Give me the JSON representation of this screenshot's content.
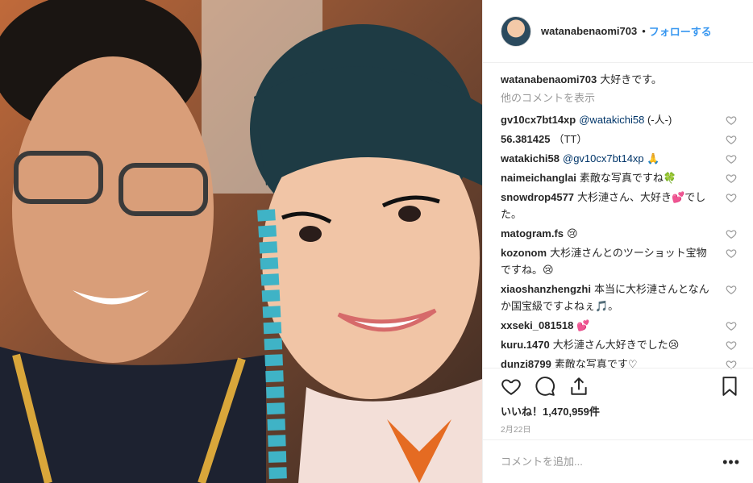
{
  "header": {
    "username": "watanabenaomi703",
    "dot": "•",
    "follow_label": "フォローする"
  },
  "caption": {
    "username": "watanabenaomi703",
    "text": "大好きです。"
  },
  "more_comments": "他のコメントを表示",
  "comments": [
    {
      "user": "gv10cx7bt14xp",
      "mention": "@watakichi58",
      "text": " (-人-)"
    },
    {
      "user": "56.381425",
      "mention": "",
      "text": "（TT）"
    },
    {
      "user": "watakichi58",
      "mention": "@gv10cx7bt14xp",
      "text": " 🙏"
    },
    {
      "user": "naimeichanglai",
      "mention": "",
      "text": "素敵な写真ですね🍀"
    },
    {
      "user": "snowdrop4577",
      "mention": "",
      "text": "大杉漣さん、大好き💕でした。"
    },
    {
      "user": "matogram.fs",
      "mention": "",
      "text": "😢"
    },
    {
      "user": "kozonom",
      "mention": "",
      "text": "大杉漣さんとのツーショット宝物ですね。😢"
    },
    {
      "user": "xiaoshanzhengzhi",
      "mention": "",
      "text": "本当に大杉漣さんとなんか国宝級ですよねぇ🎵。"
    },
    {
      "user": "xxseki_081518",
      "mention": "",
      "text": "💕"
    },
    {
      "user": "kuru.1470",
      "mention": "",
      "text": "大杉漣さん大好きでした😢"
    },
    {
      "user": "dunzi8799",
      "mention": "",
      "text": "素敵な写真です♡"
    }
  ],
  "likes": "いいね！1,470,959件",
  "date": "2月22日",
  "add_comment": {
    "placeholder": "コメントを追加..."
  },
  "options": "•••",
  "icons": {
    "like": "heart-icon",
    "comment": "comment-icon",
    "share": "share-icon",
    "save": "bookmark-icon"
  },
  "colors": {
    "link": "#3897f0",
    "muted": "#999999"
  }
}
